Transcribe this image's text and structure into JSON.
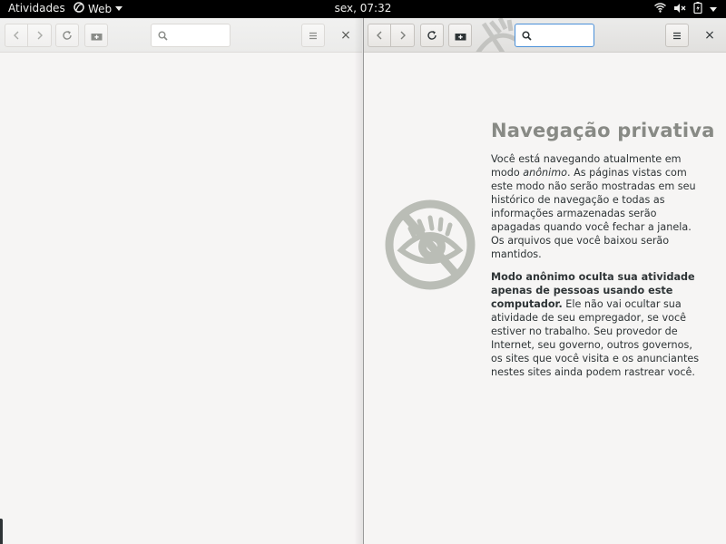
{
  "topbar": {
    "activities": "Atividades",
    "app_name": "Web",
    "clock": "sex, 07:32",
    "tray_icons": [
      "wifi-icon",
      "volume-muted-icon",
      "battery-charging-icon",
      "system-menu-caret-icon"
    ]
  },
  "left_window": {
    "url_placeholder": "",
    "close_label": "×"
  },
  "right_window": {
    "url_placeholder": "",
    "close_label": "×",
    "page": {
      "title": "Navegação privativa",
      "para1_a": "Você está navegando atualmente em modo ",
      "para1_em": "anônimo",
      "para1_b": ". As páginas vistas com este modo não serão mostradas em seu histórico de navegação e todas as informações armazenadas serão apagadas quando você fechar a janela. Os arquivos que você baixou serão mantidos.",
      "para2_bold": "Modo anônimo oculta sua atividade apenas de pessoas usando este computador.",
      "para2_rest": " Ele não vai ocultar sua atividade de seu empregador, se você estiver no trabalho. Seu provedor de Internet, seu governo, outros governos, os sites que você visita e os anunciantes nestes sites ainda podem rastrear você."
    }
  },
  "colors": {
    "topbar_bg": "#000000",
    "title_gray": "#888a85",
    "icon_gray": "#babdb6"
  }
}
